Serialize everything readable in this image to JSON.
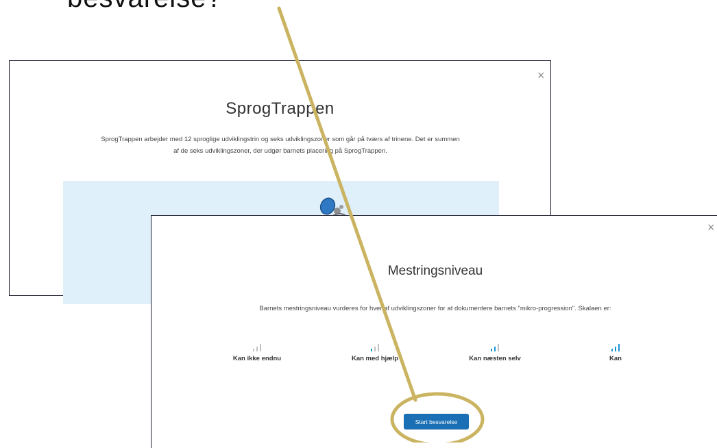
{
  "caption": {
    "text": "besvarelse?"
  },
  "dialog_sprogtrappen": {
    "title": "SprogTrappen",
    "description": "SprogTrappen arbejder med 12 sproglige udviklingstrin og seks udviklingszoner som går på tværs af trinene. Det er summen af de seks udviklingszoner, der udgør barnets placering på SprogTrappen.",
    "close_label": "×",
    "illustration_bg": "#dff0fb"
  },
  "dialog_mestring": {
    "title": "Mestringsniveau",
    "description": "Barnets mestringsniveau vurderes for hver af udviklingszoner for at dokumentere barnets \"mikro-progression\". Skalaen er:",
    "close_label": "×",
    "levels": [
      {
        "label": "Kan ikke endnu",
        "active_bars": 0
      },
      {
        "label": "Kan med hjælp",
        "active_bars": 1
      },
      {
        "label": "Kan næsten selv",
        "active_bars": 2
      },
      {
        "label": "Kan",
        "active_bars": 3
      }
    ],
    "start_button_label": "Start besvarelse",
    "level_active_color": "#1a95d6",
    "level_inactive_color": "#c2c2c2",
    "button_color": "#1a6fb5"
  },
  "annotation": {
    "color": "#cbb461"
  }
}
